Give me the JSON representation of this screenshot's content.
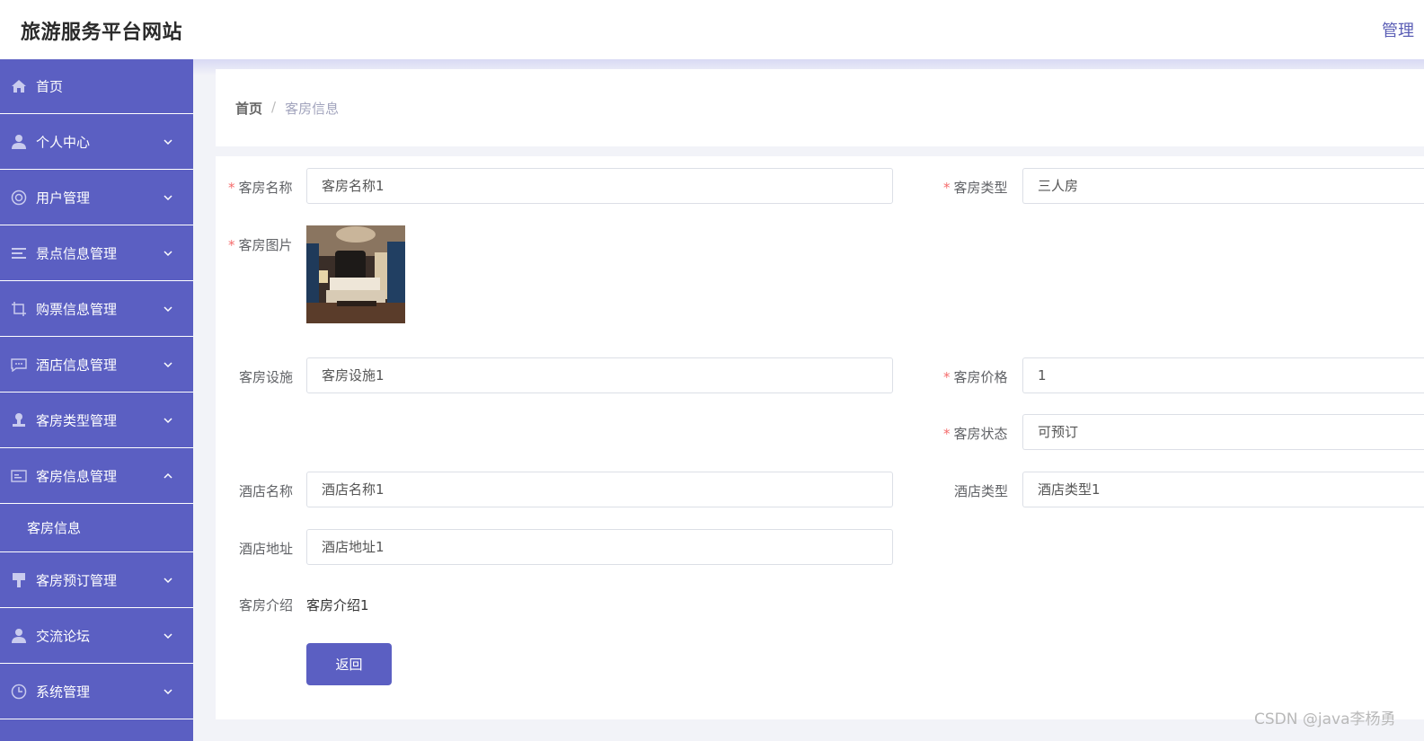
{
  "header": {
    "title": "旅游服务平台网站",
    "admin_link": "管理"
  },
  "sidebar": {
    "items": [
      {
        "label": "首页",
        "icon": "home-icon"
      },
      {
        "label": "个人中心",
        "icon": "user-icon"
      },
      {
        "label": "用户管理",
        "icon": "lifebuoy-icon"
      },
      {
        "label": "景点信息管理",
        "icon": "list-icon"
      },
      {
        "label": "购票信息管理",
        "icon": "crop-icon"
      },
      {
        "label": "酒店信息管理",
        "icon": "chat-icon"
      },
      {
        "label": "客房类型管理",
        "icon": "stamp-icon"
      },
      {
        "label": "客房信息管理",
        "icon": "card-icon"
      },
      {
        "label": "客房预订管理",
        "icon": "brush-icon"
      },
      {
        "label": "交流论坛",
        "icon": "user-icon"
      },
      {
        "label": "系统管理",
        "icon": "clock-icon"
      }
    ],
    "submenu": {
      "label": "客房信息"
    }
  },
  "breadcrumb": {
    "home": "首页",
    "separator": "/",
    "current": "客房信息"
  },
  "form": {
    "room_name": {
      "label": "客房名称",
      "value": "客房名称1",
      "required": "*"
    },
    "room_type": {
      "label": "客房类型",
      "value": "三人房",
      "required": "*"
    },
    "room_image": {
      "label": "客房图片",
      "required": "*"
    },
    "room_facilities": {
      "label": "客房设施",
      "value": "客房设施1"
    },
    "room_price": {
      "label": "客房价格",
      "value": "1",
      "required": "*"
    },
    "room_status": {
      "label": "客房状态",
      "value": "可预订",
      "required": "*"
    },
    "hotel_name": {
      "label": "酒店名称",
      "value": "酒店名称1"
    },
    "hotel_type": {
      "label": "酒店类型",
      "value": "酒店类型1"
    },
    "hotel_address": {
      "label": "酒店地址",
      "value": "酒店地址1"
    },
    "room_intro": {
      "label": "客房介绍",
      "value": "客房介绍1"
    },
    "back_label": "返回"
  },
  "watermark": "CSDN @java李杨勇",
  "colors": {
    "sidebar_bg": "#5b5fc2",
    "accent": "#5b5fc2",
    "required": "#f56c6c"
  }
}
